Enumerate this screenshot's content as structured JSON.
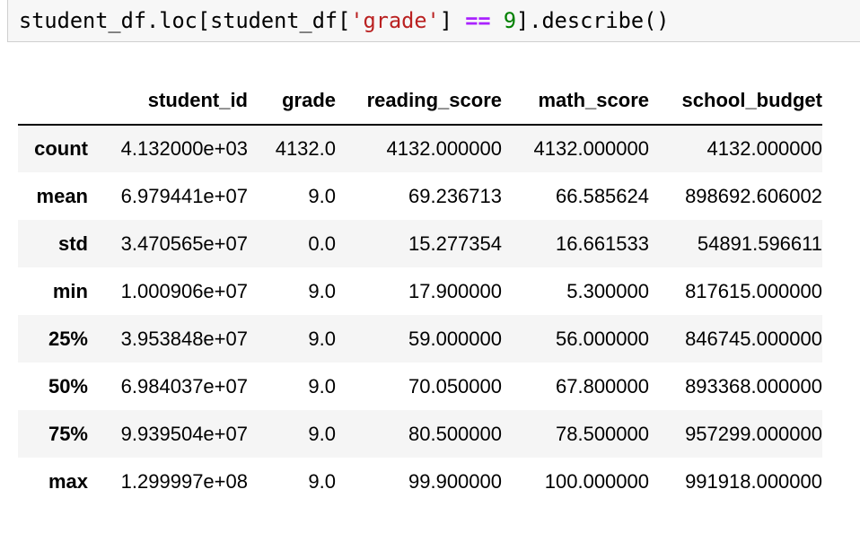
{
  "code": {
    "prefix": "student_df.loc[student_df[",
    "string": "'grade'",
    "middle": "] ",
    "operator": "==",
    "space": " ",
    "number": "9",
    "suffix": "].describe()"
  },
  "table": {
    "columns": [
      "student_id",
      "grade",
      "reading_score",
      "math_score",
      "school_budget"
    ],
    "rows": [
      {
        "label": "count",
        "values": [
          "4.132000e+03",
          "4132.0",
          "4132.000000",
          "4132.000000",
          "4132.000000"
        ]
      },
      {
        "label": "mean",
        "values": [
          "6.979441e+07",
          "9.0",
          "69.236713",
          "66.585624",
          "898692.606002"
        ]
      },
      {
        "label": "std",
        "values": [
          "3.470565e+07",
          "0.0",
          "15.277354",
          "16.661533",
          "54891.596611"
        ]
      },
      {
        "label": "min",
        "values": [
          "1.000906e+07",
          "9.0",
          "17.900000",
          "5.300000",
          "817615.000000"
        ]
      },
      {
        "label": "25%",
        "values": [
          "3.953848e+07",
          "9.0",
          "59.000000",
          "56.000000",
          "846745.000000"
        ]
      },
      {
        "label": "50%",
        "values": [
          "6.984037e+07",
          "9.0",
          "70.050000",
          "67.800000",
          "893368.000000"
        ]
      },
      {
        "label": "75%",
        "values": [
          "9.939504e+07",
          "9.0",
          "80.500000",
          "78.500000",
          "957299.000000"
        ]
      },
      {
        "label": "max",
        "values": [
          "1.299997e+08",
          "9.0",
          "99.900000",
          "100.000000",
          "991918.000000"
        ]
      }
    ]
  }
}
